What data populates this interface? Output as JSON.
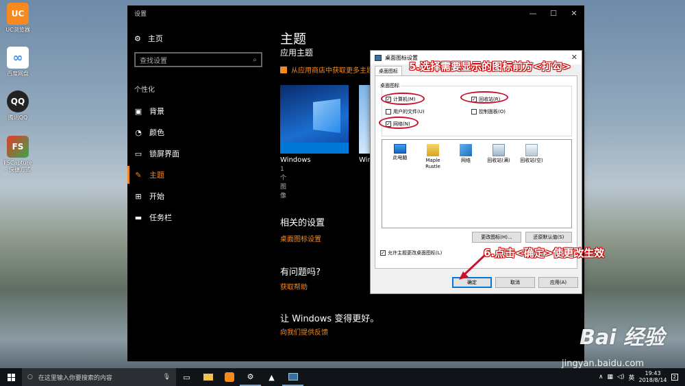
{
  "desktop": {
    "icons": [
      {
        "label": "UC浏览器",
        "color": "#f68a1e",
        "glyph": "UC"
      },
      {
        "label": "百度网盘",
        "color": "#3b8ee8",
        "glyph": "∞"
      },
      {
        "label": "腾讯QQ",
        "color": "#ffffff",
        "glyph": "QQ"
      },
      {
        "label": "FSCapture - 快捷方式",
        "color": "#e23b2e",
        "glyph": "FS"
      }
    ]
  },
  "settings": {
    "window_title": "设置",
    "nav": {
      "home": "主页",
      "search_placeholder": "查找设置",
      "group_label": "个性化",
      "items": [
        {
          "label": "背景",
          "icon": "picture-icon"
        },
        {
          "label": "颜色",
          "icon": "palette-icon"
        },
        {
          "label": "锁屏界面",
          "icon": "monitor-icon"
        },
        {
          "label": "主题",
          "icon": "brush-icon",
          "active": true
        },
        {
          "label": "开始",
          "icon": "start-icon"
        },
        {
          "label": "任务栏",
          "icon": "taskbar-icon"
        }
      ]
    },
    "main": {
      "title": "主题",
      "subtitle": "应用主题",
      "store_link": "从应用商店中获取更多主题",
      "themes": [
        {
          "name": "Windows",
          "count": "1 个图像"
        },
        {
          "name": "Win"
        }
      ],
      "related_title": "相关的设置",
      "related_link": "桌面图标设置",
      "help_title": "有问题吗?",
      "help_link": "获取帮助",
      "feedback_title": "让 Windows 变得更好。",
      "feedback_link": "向我们提供反馈"
    }
  },
  "dialog": {
    "title": "桌面图标设置",
    "tab": "桌面图标",
    "group_label": "桌面图标",
    "checkboxes": [
      {
        "label": "计算机(M)",
        "checked": true
      },
      {
        "label": "回收站(R)",
        "checked": true
      },
      {
        "label": "用户的文件(U)",
        "checked": false
      },
      {
        "label": "控制面板(O)",
        "checked": false
      },
      {
        "label": "网络(N)",
        "checked": true
      }
    ],
    "icon_items": [
      "此电脑",
      "Maple Rustle",
      "网络",
      "回收站(满)",
      "回收站(空)"
    ],
    "change_icon_btn": "更改图标(H)...",
    "restore_btn": "还原默认值(S)",
    "allow_themes": "允许主题更改桌面图标(L)",
    "ok": "确定",
    "cancel": "取消",
    "apply": "应用(A)"
  },
  "annotations": {
    "step5": "5.选择需要显示的图标前方<打勾>",
    "step6": "6.点击<确定>使更改生效"
  },
  "watermark": {
    "brand": "Bai 经验",
    "url": "jingyan.baidu.com"
  },
  "taskbar": {
    "search_placeholder": "在这里输入你要搜索的内容",
    "ime": "英",
    "time": "19:43",
    "date": "2018/8/14",
    "notification_count": "2"
  },
  "colors": {
    "accent": "#f68a1e",
    "annotation": "#c8102e",
    "dialog_primary": "#0078d7"
  }
}
